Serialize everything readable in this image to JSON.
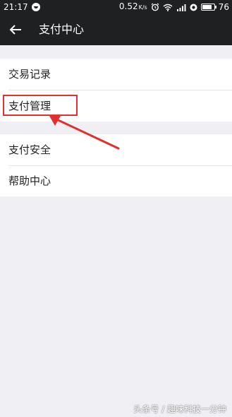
{
  "status_bar": {
    "time": "21:17",
    "net_speed": "0.52",
    "net_unit": "K/s",
    "battery": "76",
    "battery_level": 0.76
  },
  "app_bar": {
    "back_icon": "arrow-left-icon",
    "title": "支付中心"
  },
  "menu": {
    "group1": [
      {
        "label": "交易记录"
      },
      {
        "label": "支付管理"
      }
    ],
    "group2": [
      {
        "label": "支付安全"
      },
      {
        "label": "帮助中心"
      }
    ]
  },
  "annotation": {
    "color": "#e03131"
  },
  "watermark": "头条号 / 趣味科技一分钟"
}
